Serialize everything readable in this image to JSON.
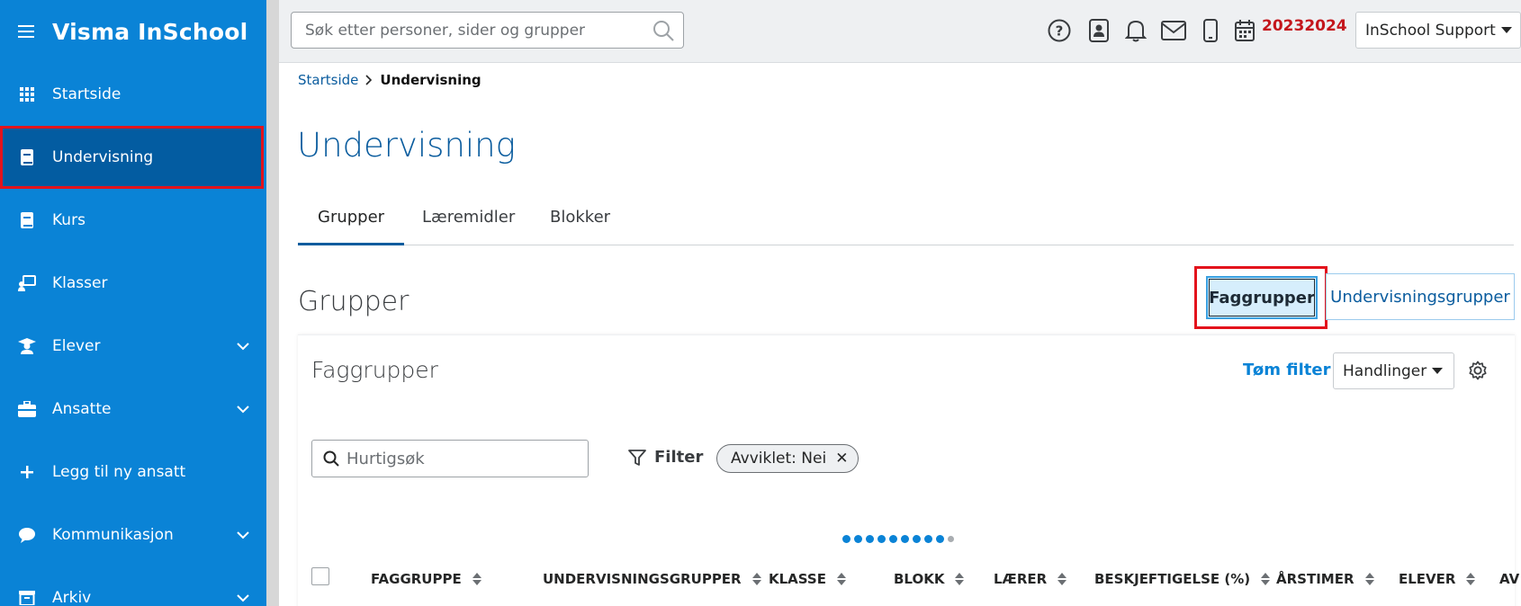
{
  "app": {
    "title": "Visma InSchool"
  },
  "sidebar": {
    "items": [
      {
        "label": "Startside",
        "icon": "grid-icon"
      },
      {
        "label": "Undervisning",
        "icon": "book-icon",
        "active": true
      },
      {
        "label": "Kurs",
        "icon": "book-icon"
      },
      {
        "label": "Klasser",
        "icon": "classroom-icon"
      },
      {
        "label": "Elever",
        "icon": "student-icon",
        "expandable": true
      },
      {
        "label": "Ansatte",
        "icon": "briefcase-icon",
        "expandable": true
      },
      {
        "label": "Legg til ny ansatt",
        "icon": "plus-icon"
      },
      {
        "label": "Kommunikasjon",
        "icon": "chat-icon",
        "expandable": true
      },
      {
        "label": "Arkiv",
        "icon": "archive-icon",
        "expandable": true
      }
    ]
  },
  "topbar": {
    "search_placeholder": "Søk etter personer, sider og grupper",
    "icons": [
      "help-icon",
      "contacts-icon",
      "bell-icon",
      "mail-icon",
      "mobile-icon",
      "calendar-icon"
    ],
    "school_year": "20232024",
    "user": "InSchool Support"
  },
  "breadcrumb": {
    "home": "Startside",
    "current": "Undervisning"
  },
  "page": {
    "title": "Undervisning"
  },
  "tabs": [
    {
      "label": "Grupper",
      "active": true
    },
    {
      "label": "Læremidler"
    },
    {
      "label": "Blokker"
    }
  ],
  "section": {
    "title": "Grupper",
    "toggle": {
      "faggrupper": "Faggrupper",
      "undervisningsgrupper": "Undervisningsgrupper"
    }
  },
  "card": {
    "title": "Faggrupper",
    "clear_filter": "Tøm filter",
    "actions": "Handlinger",
    "quick_search_placeholder": "Hurtigsøk",
    "filter_label": "Filter",
    "chip": "Avviklet: Nei",
    "columns": [
      "FAGGRUPPE",
      "UNDERVISNINGSGRUPPER",
      "KLASSE",
      "BLOKK",
      "LÆRER",
      "BESKJEFTIGELSE (%)",
      "ÅRSTIMER",
      "ELEVER",
      "AV"
    ]
  },
  "colors": {
    "sidebar_bg": "#0a83d6",
    "sidebar_active": "#035ca1",
    "primary_text": "#0a5c9e",
    "year_red": "#c4161c",
    "highlight_red": "#e3131c"
  }
}
